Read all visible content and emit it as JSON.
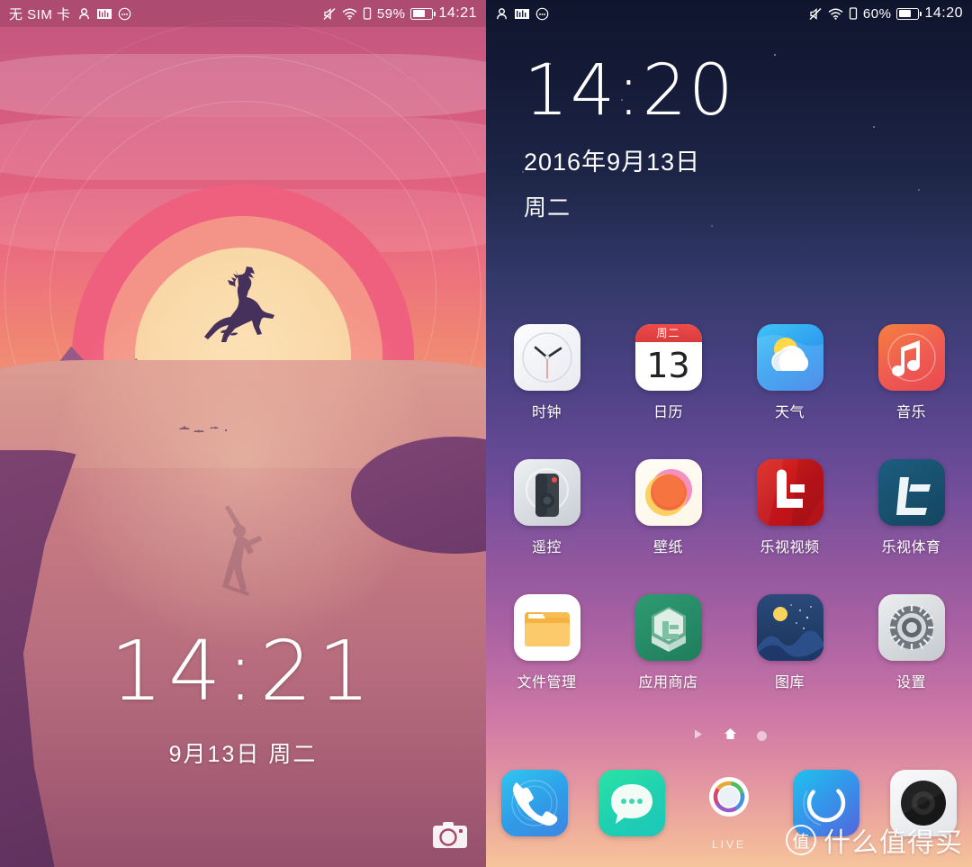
{
  "left_screen": {
    "type": "lock-screen",
    "status_bar": {
      "sim": "无 SIM 卡",
      "icons_left": [
        "person-icon",
        "signal-bars-icon",
        "more-dots-icon"
      ],
      "icons_right": [
        "mute-icon",
        "wifi-icon",
        "vibrate-icon"
      ],
      "battery_percent": "59%",
      "battery_level": 59,
      "time": "14:21"
    },
    "clock": {
      "time": "14:21",
      "date": "9月13日  周二"
    },
    "camera_shortcut": "camera-icon",
    "wallpaper": {
      "theme": "sunset-deer-illustration",
      "sky_top": "#c0567f",
      "sky_bottom": "#ef9a79",
      "sun_core": "#fbe2b4",
      "ground_top": "#d58a85",
      "ground_bottom": "#96506c",
      "river": "#6b3865"
    }
  },
  "right_screen": {
    "type": "home-screen",
    "status_bar": {
      "icons_left": [
        "person-icon",
        "signal-bars-icon",
        "more-dots-icon"
      ],
      "icons_right": [
        "mute-icon",
        "wifi-icon",
        "vibrate-icon"
      ],
      "battery_percent": "60%",
      "battery_level": 60,
      "time": "14:20"
    },
    "clock_widget": {
      "time": "14:20",
      "date": "2016年9月13日",
      "weekday": "周二"
    },
    "app_grid": [
      [
        {
          "label": "时钟",
          "icon": "clock-icon"
        },
        {
          "label": "日历",
          "icon": "calendar-icon",
          "badge_top": "周二",
          "badge_day": "13"
        },
        {
          "label": "天气",
          "icon": "weather-icon"
        },
        {
          "label": "音乐",
          "icon": "music-icon"
        }
      ],
      [
        {
          "label": "遥控",
          "icon": "remote-control-icon"
        },
        {
          "label": "壁纸",
          "icon": "wallpaper-icon"
        },
        {
          "label": "乐视视频",
          "icon": "letv-video-icon"
        },
        {
          "label": "乐视体育",
          "icon": "letv-sports-icon"
        }
      ],
      [
        {
          "label": "文件管理",
          "icon": "file-manager-icon"
        },
        {
          "label": "应用商店",
          "icon": "app-store-icon"
        },
        {
          "label": "图库",
          "icon": "gallery-icon"
        },
        {
          "label": "设置",
          "icon": "settings-gear-icon"
        }
      ]
    ],
    "page_indicator": {
      "items": [
        "play-triangle-icon",
        "home-icon",
        "dot-icon"
      ],
      "active_index": 1
    },
    "dock": [
      {
        "label": "",
        "icon": "phone-icon"
      },
      {
        "label": "",
        "icon": "message-bubble-icon"
      },
      {
        "label": "LIVE",
        "icon": "live-ring-icon"
      },
      {
        "label": "",
        "icon": "browser-ring-icon"
      },
      {
        "label": "",
        "icon": "camera-lens-icon"
      }
    ],
    "watermark": {
      "logo": "值",
      "text": "什么值得买"
    }
  }
}
